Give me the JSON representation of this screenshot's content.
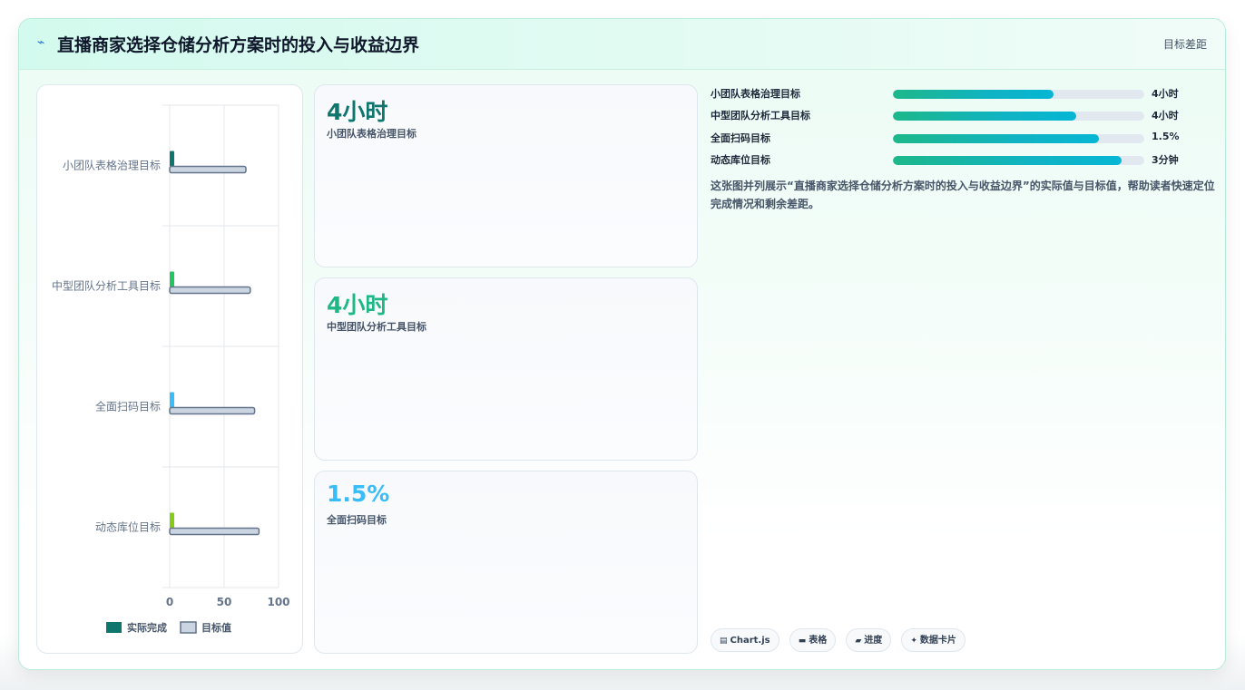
{
  "header": {
    "icon": "sparkline-icon",
    "title": "直播商家选择仓储分析方案时的投入与收益边界",
    "right_label": "目标差距"
  },
  "chart_data": {
    "type": "bar",
    "orientation": "horizontal",
    "categories": [
      "小团队表格治理目标",
      "中型团队分析工具目标",
      "全面扫码目标",
      "动态库位目标"
    ],
    "series": [
      {
        "name": "实际完成",
        "values": [
          4,
          4,
          4,
          4
        ],
        "colors": [
          "#0f766e",
          "#22c55e",
          "#38bdf8",
          "#84cc16"
        ]
      },
      {
        "name": "目标值",
        "values": [
          70,
          74,
          78,
          82
        ],
        "color": "#cbd5e1",
        "stroke": "#64748b"
      }
    ],
    "xlim": [
      0,
      100
    ],
    "xticks": [
      "0",
      "50",
      "100"
    ],
    "grid": true,
    "legend_position": "bottom",
    "legend": [
      {
        "label": "实际完成",
        "color": "#0f766e"
      },
      {
        "label": "目标值",
        "color": "#cbd5e1"
      }
    ]
  },
  "kpis": [
    {
      "value": "4小时",
      "label": "小团队表格治理目标",
      "color": "#0f766e"
    },
    {
      "value": "4小时",
      "label": "中型团队分析工具目标",
      "color": "#1db886"
    },
    {
      "value": "1.5%",
      "label": "全面扫码目标",
      "color": "#38bdf8"
    }
  ],
  "progress": [
    {
      "label": "小团队表格治理目标",
      "value": "4小时",
      "fraction": 0.64
    },
    {
      "label": "中型团队分析工具目标",
      "value": "4小时",
      "fraction": 0.73
    },
    {
      "label": "全面扫码目标",
      "value": "1.5%",
      "fraction": 0.82
    },
    {
      "label": "动态库位目标",
      "value": "3分钟",
      "fraction": 0.91
    }
  ],
  "description": "这张图并列展示“直播商家选择仓储分析方案时的投入与收益边界”的实际值与目标值，帮助读者快速定位完成情况和剩余差距。",
  "tags": [
    {
      "icon": "chart-icon",
      "glyph": "▤",
      "label": "Chart.js"
    },
    {
      "icon": "table-icon",
      "glyph": "▬",
      "label": "表格"
    },
    {
      "icon": "progress-icon",
      "glyph": "▰",
      "label": "进度"
    },
    {
      "icon": "card-icon",
      "glyph": "✦",
      "label": "数据卡片"
    }
  ]
}
